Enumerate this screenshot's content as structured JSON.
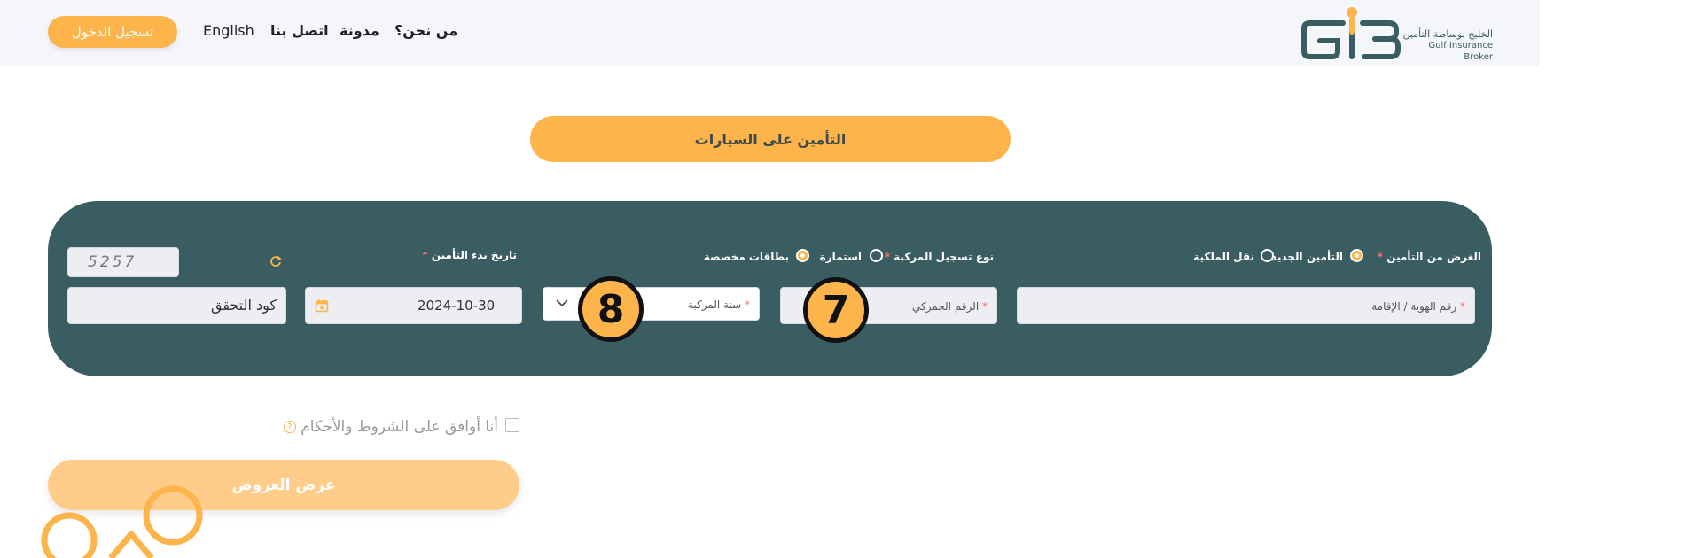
{
  "nav": {
    "login": "تسجيل الدخول",
    "language": "English",
    "contact": "اتصل بنا",
    "blog": "مدونة",
    "about": "من نحن؟"
  },
  "logo": {
    "arabic": "الخليج لوساطة التأمين",
    "english": "Gulf Insurance Broker"
  },
  "page_title": "التأمين على السيارات",
  "form": {
    "purpose_label": "الغرض من التأمين",
    "purpose_options": [
      "التأمين الجديد",
      "نقل الملكية"
    ],
    "purpose_selected": "التأمين الجديد",
    "registration_label": "نوع تسجيل المركبة",
    "registration_options": [
      "استمارة",
      "بطاقات مخصصة"
    ],
    "registration_selected": "بطاقات مخصصة",
    "start_date_label": "تاريخ بدء التأمين",
    "required_mark": "*",
    "id_placeholder": "رقم الهوية / الإقامة",
    "customs_placeholder": "الرقم الجمركي",
    "year_placeholder": "سنة المركبة",
    "start_date_value": "2024-10-30",
    "captcha_placeholder": "كود التحقق",
    "captcha_text": "5257"
  },
  "markers": [
    "7",
    "8"
  ],
  "terms": {
    "text": "أنا أوافق على الشروط والأحكام",
    "help": "?"
  },
  "offers_button": "عرض العروض",
  "colors": {
    "accent": "#fdb44b",
    "panel": "#3a5d62",
    "topbar": "#f5f6fa"
  }
}
